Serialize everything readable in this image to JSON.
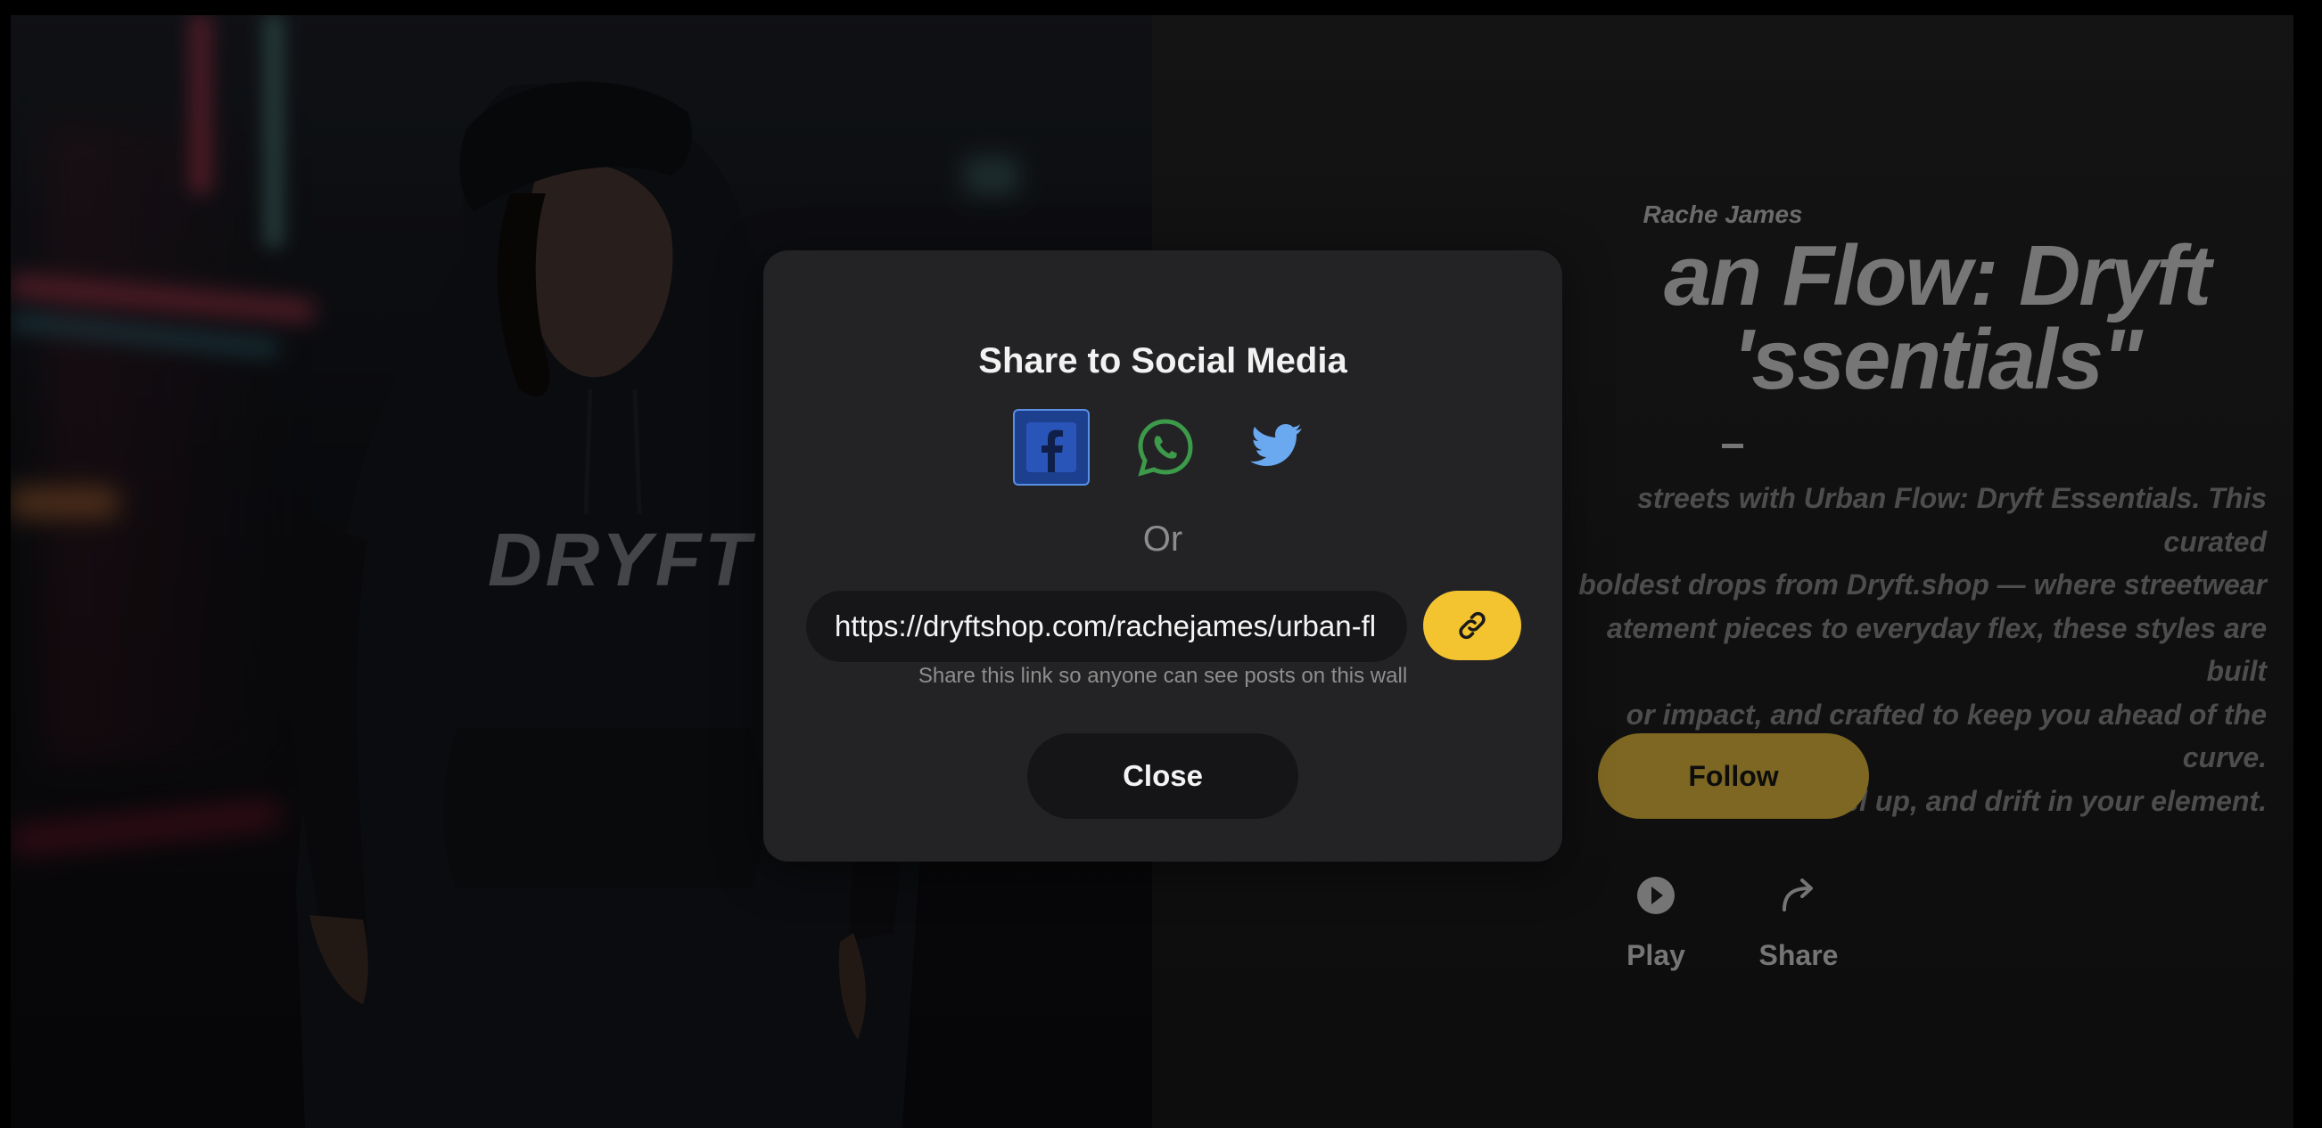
{
  "hero": {
    "image_alt": "Woman in black hoodie with DRYFT logo on neon city street",
    "hoodie_text": "DRYFT"
  },
  "wall": {
    "author": "Rache James",
    "title_line1": "an Flow: Dryft",
    "title_line2": "'ssentials\"",
    "description_lines": [
      "streets with Urban Flow: Dryft Essentials. This curated",
      "boldest drops from Dryft.shop — where streetwear",
      "atement pieces to everyday flex, these styles are built",
      "or impact, and crafted to keep you ahead of the curve.",
      "level up, and drift in your element."
    ],
    "follow_label": "Follow",
    "play_label": "Play",
    "share_label": "Share"
  },
  "share_modal": {
    "title": "Share to Social Media",
    "networks": [
      {
        "name": "Facebook",
        "icon": "facebook-icon"
      },
      {
        "name": "WhatsApp",
        "icon": "whatsapp-icon"
      },
      {
        "name": "Twitter",
        "icon": "twitter-icon"
      }
    ],
    "or_label": "Or",
    "link_value": "https://dryftshop.com/rachejames/urban-fl",
    "hint": "Share this link so anyone can see posts on this wall",
    "copy_icon": "link-icon",
    "close_label": "Close"
  },
  "colors": {
    "accent_yellow": "#f3c430",
    "follow_gold": "#b49432",
    "modal_bg": "#232325",
    "facebook_blue": "#1c3f8e",
    "whatsapp_green": "#3c9a4a",
    "twitter_blue": "#6aa8f0"
  }
}
